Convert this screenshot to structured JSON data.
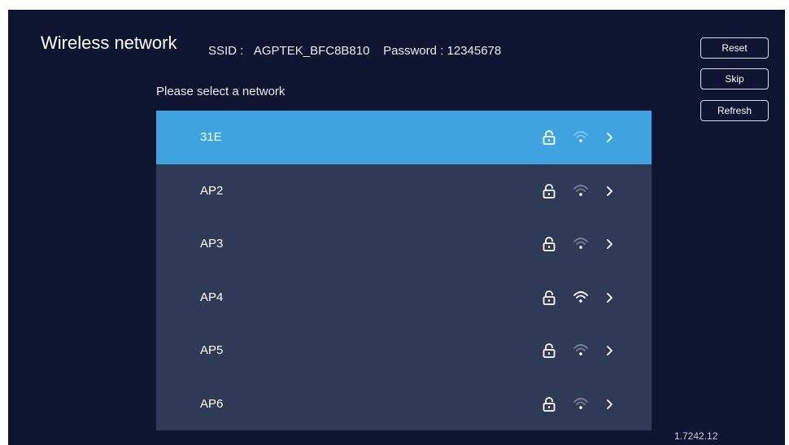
{
  "header": {
    "title": "Wireless network",
    "ssid_label": "SSID :",
    "ssid_value": "AGPTEK_BFC8B810",
    "password_label": "Password : 12345678"
  },
  "prompt": "Please select a network",
  "buttons": {
    "reset": "Reset",
    "skip": "Skip",
    "refresh": "Refresh"
  },
  "networks": [
    {
      "name": "31E",
      "selected": true,
      "locked": true,
      "signal": "weak"
    },
    {
      "name": "AP2",
      "selected": false,
      "locked": true,
      "signal": "weak"
    },
    {
      "name": "AP3",
      "selected": false,
      "locked": true,
      "signal": "weak"
    },
    {
      "name": "AP4",
      "selected": false,
      "locked": true,
      "signal": "strong"
    },
    {
      "name": "AP5",
      "selected": false,
      "locked": true,
      "signal": "weak"
    },
    {
      "name": "AP6",
      "selected": false,
      "locked": true,
      "signal": "weak"
    }
  ],
  "version": "1.7242.12",
  "colors": {
    "background": "#0e1530",
    "list": "#2f3a56",
    "selected": "#3fa3e0"
  }
}
